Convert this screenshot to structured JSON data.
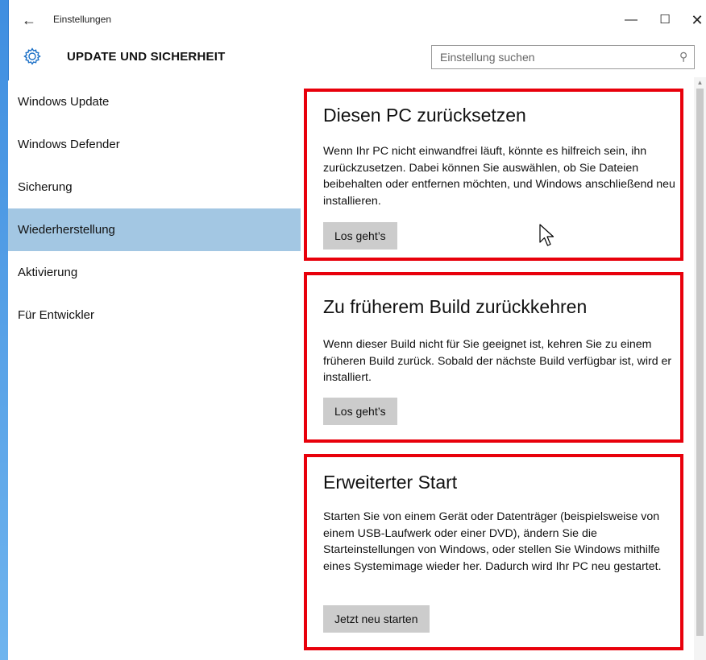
{
  "window": {
    "title": "Einstellungen",
    "back_glyph": "←",
    "min_glyph": "—",
    "max_glyph": "☐",
    "close_glyph": "✕"
  },
  "header": {
    "title": "UPDATE UND SICHERHEIT",
    "icon": "gear-icon"
  },
  "search": {
    "placeholder": "Einstellung suchen"
  },
  "sidebar": {
    "items": [
      {
        "label": "Windows Update",
        "active": false
      },
      {
        "label": "Windows Defender",
        "active": false
      },
      {
        "label": "Sicherung",
        "active": false
      },
      {
        "label": "Wiederherstellung",
        "active": true
      },
      {
        "label": "Aktivierung",
        "active": false
      },
      {
        "label": "Für Entwickler",
        "active": false
      }
    ]
  },
  "sections": [
    {
      "heading": "Diesen PC zurücksetzen",
      "body": "Wenn Ihr PC nicht einwandfrei läuft, könnte es hilfreich sein, ihn zurückzusetzen. Dabei können Sie auswählen, ob Sie Dateien beibehalten oder entfernen möchten, und Windows anschließend neu installieren.",
      "button": "Los geht’s"
    },
    {
      "heading": "Zu früherem Build zurückkehren",
      "body": "Wenn dieser Build nicht für Sie geeignet ist, kehren Sie zu einem früheren Build zurück. Sobald der nächste Build verfügbar ist, wird er installiert.",
      "button": "Los geht’s"
    },
    {
      "heading": "Erweiterter Start",
      "body": "Starten Sie von einem Gerät oder Datenträger (beispielsweise von einem USB-Laufwerk oder einer DVD), ändern Sie die Starteinstellungen von Windows, oder stellen Sie Windows mithilfe eines Systemimage wieder her. Dadurch wird Ihr PC neu gestartet.",
      "button": "Jetzt neu starten"
    }
  ],
  "colors": {
    "accent": "#1a6fc6",
    "highlight_border": "#e8000b",
    "sidebar_active": "#a3c7e3",
    "button_bg": "#cccccc"
  }
}
